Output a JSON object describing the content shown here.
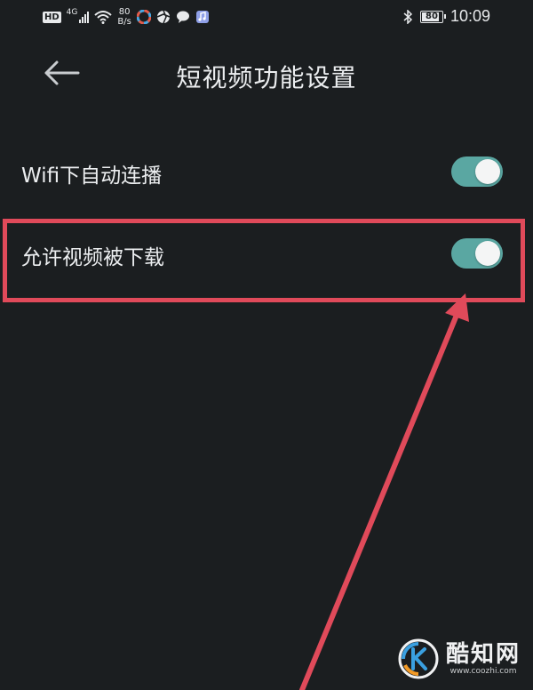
{
  "status_bar": {
    "hd": "HD",
    "network": "4G",
    "speed_value": "80",
    "speed_unit": "B/s",
    "battery": "80",
    "battery_level": 0.8,
    "time": "10:09"
  },
  "header": {
    "title": "短视频功能设置"
  },
  "settings": [
    {
      "label": "Wifi下自动连播",
      "enabled": true
    },
    {
      "label": "允许视频被下载",
      "enabled": true
    }
  ],
  "colors": {
    "toggle_on": "#5aa7a2",
    "annotation": "#e04a5a",
    "background": "#1b1e20"
  },
  "watermark": {
    "name": "酷知网",
    "url": "www.coozhi.com"
  }
}
